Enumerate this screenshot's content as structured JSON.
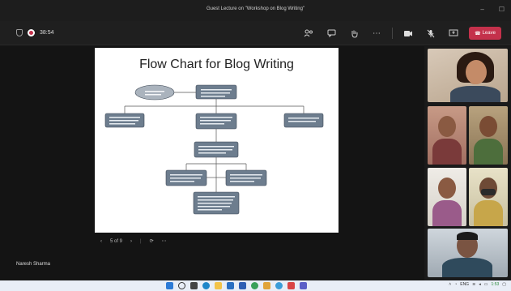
{
  "window": {
    "title": "Guest Lecture on \"Workshop on Blog Writing\""
  },
  "toolbar": {
    "timer": "38:54",
    "leave_label": "Leave"
  },
  "slide": {
    "title": "Flow Chart for Blog Writing",
    "counter": "5 of 9"
  },
  "presenter": {
    "name": "Naresh Sharma"
  },
  "colors": {
    "leave": "#c4314b",
    "slide_bg": "#ffffff",
    "flow_box": "#6d7d8e"
  },
  "icons": [
    "shield-icon",
    "record-icon",
    "people-icon",
    "chat-icon",
    "reactions-icon",
    "more-icon",
    "camera-icon",
    "mic-icon",
    "share-icon",
    "phone-icon"
  ],
  "tray": {
    "lang": "ENG",
    "time": "1:53",
    "date": ""
  }
}
